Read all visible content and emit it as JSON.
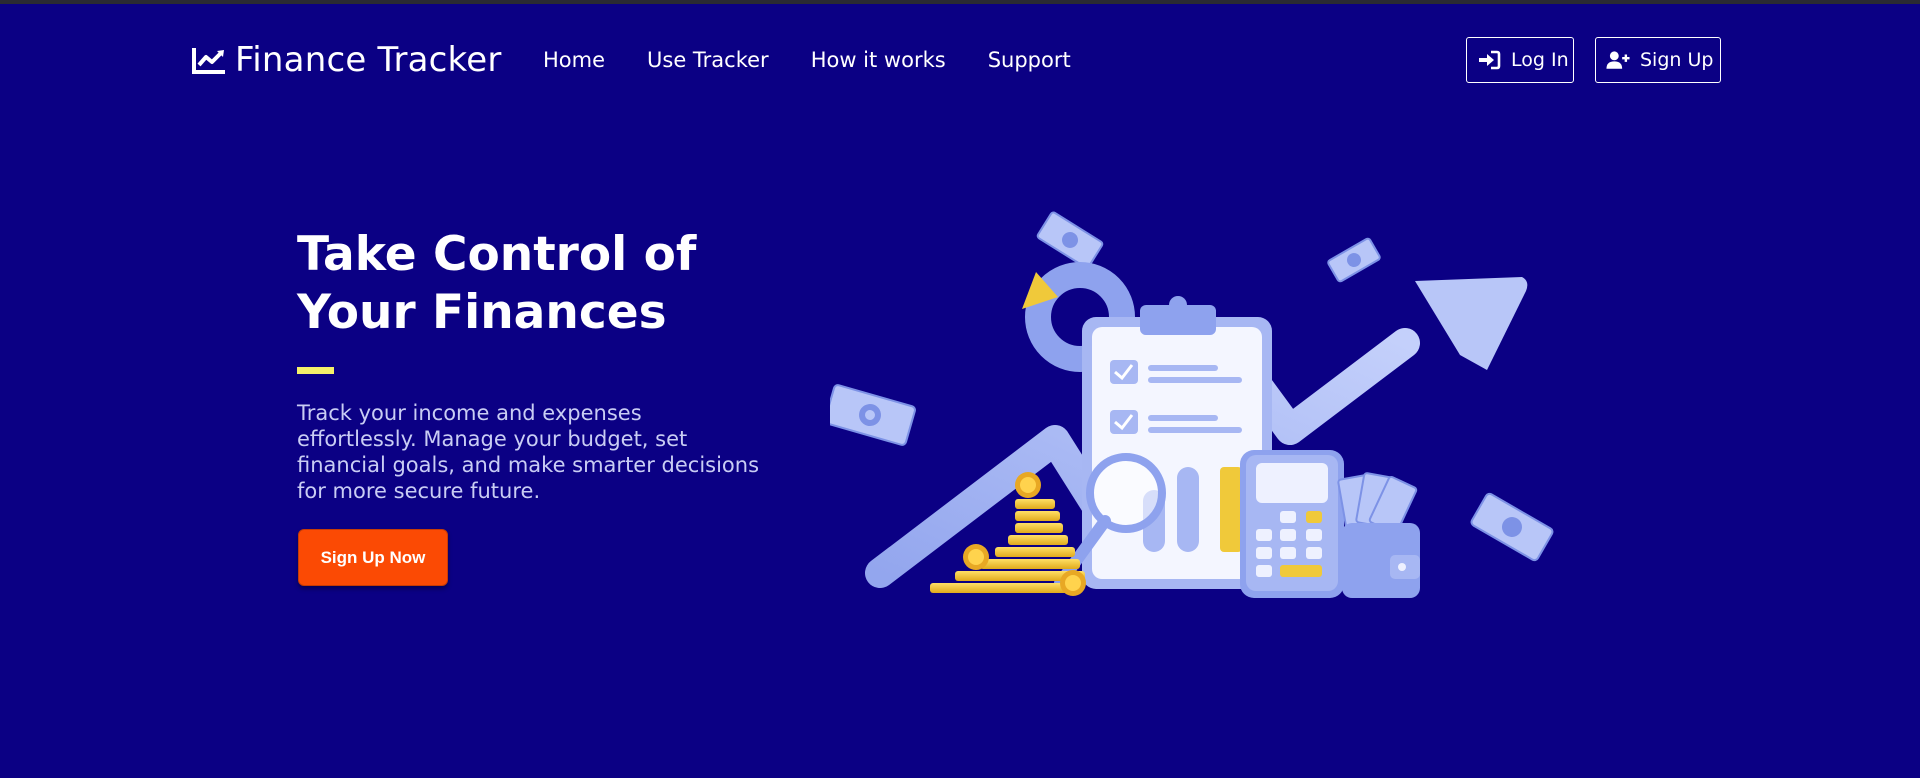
{
  "nav": {
    "brand": "Finance Tracker",
    "links": [
      "Home",
      "Use Tracker",
      "How it works",
      "Support"
    ],
    "login_label": "Log In",
    "signup_label": "Sign Up"
  },
  "hero": {
    "title_line1": "Take Control of",
    "title_line2": "Your Finances",
    "subtitle": "Track your income and expenses effortlessly. Manage your budget, set financial goals, and make smarter decisions for more secure future.",
    "cta_label": "Sign Up Now"
  },
  "colors": {
    "background": "#0b0084",
    "accent_bar": "#f5f06a",
    "cta": "#fb4a04",
    "illustration_blue": "#a7b7f3",
    "illustration_gold": "#f0c93a"
  },
  "icons": {
    "brand": "line-chart-icon",
    "login": "sign-in-icon",
    "signup": "user-plus-icon"
  }
}
